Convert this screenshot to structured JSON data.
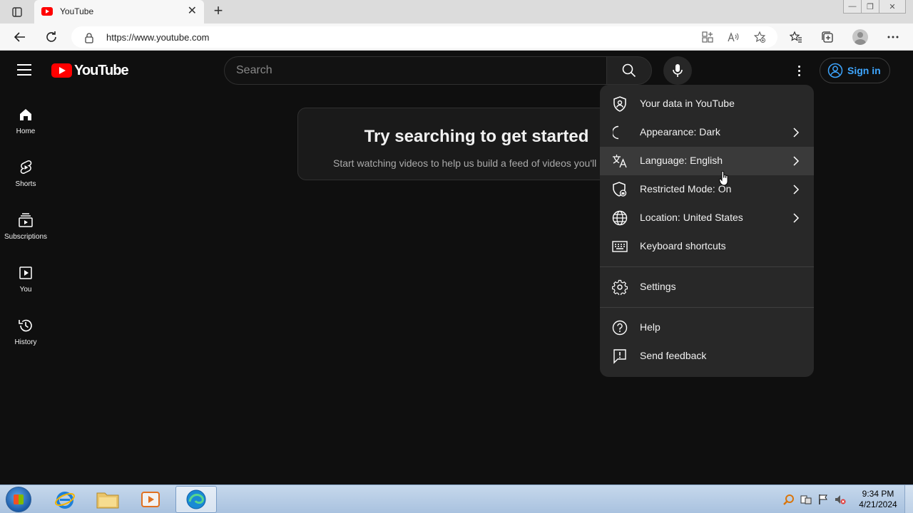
{
  "browser": {
    "tab": {
      "title": "YouTube",
      "close": "✕"
    },
    "new_tab": "+",
    "window_controls": {
      "minimize": "—",
      "restore": "❐",
      "close": "✕"
    },
    "url": "https://www.youtube.com"
  },
  "youtube": {
    "brand": "YouTube",
    "search": {
      "placeholder": "Search"
    },
    "sign_in": "Sign in",
    "sidebar": [
      {
        "label": "Home",
        "icon": "home-icon"
      },
      {
        "label": "Shorts",
        "icon": "shorts-icon"
      },
      {
        "label": "Subscriptions",
        "icon": "subscriptions-icon"
      },
      {
        "label": "You",
        "icon": "you-icon"
      },
      {
        "label": "History",
        "icon": "history-icon"
      }
    ],
    "prompt": {
      "heading": "Try searching to get started",
      "subtext": "Start watching videos to help us build a feed of videos you'll love."
    },
    "menu": {
      "items": [
        {
          "label": "Your data in YouTube",
          "icon": "shield-person-icon",
          "submenu": false
        },
        {
          "label": "Appearance: Dark",
          "icon": "moon-icon",
          "submenu": true
        },
        {
          "label": "Language: English",
          "icon": "translate-icon",
          "submenu": true,
          "hovered": true
        },
        {
          "label": "Restricted Mode: On",
          "icon": "restricted-icon",
          "submenu": true
        },
        {
          "label": "Location: United States",
          "icon": "globe-icon",
          "submenu": true
        },
        {
          "label": "Keyboard shortcuts",
          "icon": "keyboard-icon",
          "submenu": false
        },
        {
          "label": "Settings",
          "icon": "gear-icon",
          "submenu": false
        },
        {
          "label": "Help",
          "icon": "help-icon",
          "submenu": false
        },
        {
          "label": "Send feedback",
          "icon": "feedback-icon",
          "submenu": false
        }
      ]
    }
  },
  "taskbar": {
    "time": "9:34 PM",
    "date": "4/21/2024"
  },
  "colors": {
    "page_bg": "#0f0f0f",
    "menu_bg": "#282828",
    "brand_red": "#ff0000",
    "signin_blue": "#3ea6ff"
  }
}
